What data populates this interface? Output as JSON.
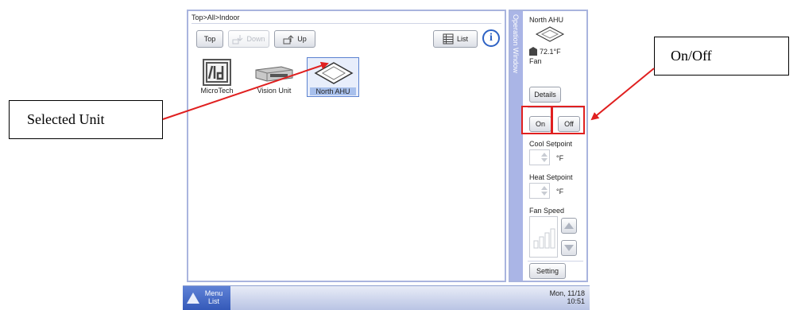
{
  "nav": {
    "breadcrumb": "Top>All>Indoor",
    "buttons": {
      "top": "Top",
      "down": "Down",
      "up": "Up",
      "list": "List"
    },
    "units": [
      {
        "label": "MicroTech",
        "icon": "microtech-icon"
      },
      {
        "label": "Vision Unit",
        "icon": "ducted-unit-icon"
      },
      {
        "label": "North AHU",
        "icon": "ceiling-cassette-icon",
        "selected": true
      }
    ]
  },
  "operation": {
    "tab_label": "Operation Window",
    "unit_name": "North AHU",
    "temperature": "72.1°F",
    "mode": "Fan",
    "details": "Details",
    "on": "On",
    "off": "Off",
    "cool_setpoint": "Cool Setpoint",
    "heat_setpoint": "Heat Setpoint",
    "temp_unit": "°F",
    "fan_speed": "Fan Speed",
    "setting": "Setting"
  },
  "bottom_bar": {
    "menu_line1": "Menu",
    "menu_line2": "List",
    "date": "Mon, 11/18",
    "time": "10:51"
  },
  "annotations": {
    "selected_unit": "Selected Unit",
    "on_off": "On/Off"
  },
  "colors": {
    "panel_border": "#a9b4de",
    "highlight_box": "#e02020",
    "arrow": "#e02020"
  }
}
